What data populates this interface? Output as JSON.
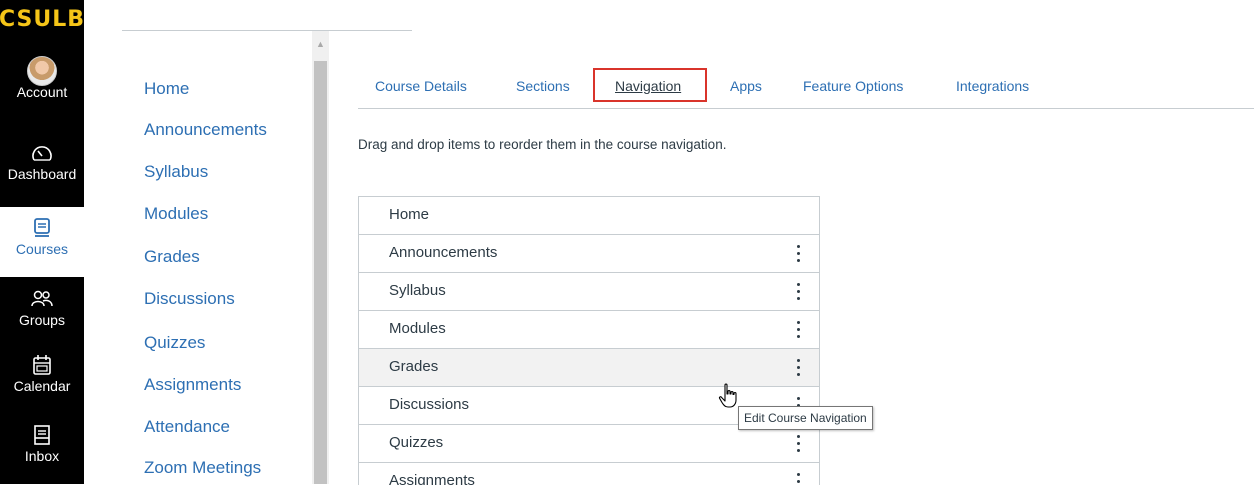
{
  "global_nav": {
    "logo": "CSULB",
    "items": [
      {
        "label": "Account",
        "icon": "avatar"
      },
      {
        "label": "Dashboard",
        "icon": "dashboard-icon"
      },
      {
        "label": "Courses",
        "icon": "courses-icon",
        "active": true
      },
      {
        "label": "Groups",
        "icon": "groups-icon"
      },
      {
        "label": "Calendar",
        "icon": "calendar-icon"
      },
      {
        "label": "Inbox",
        "icon": "inbox-icon"
      }
    ],
    "active_color": "#2d6fb3"
  },
  "course_nav": {
    "items": [
      "Home",
      "Announcements",
      "Syllabus",
      "Modules",
      "Grades",
      "Discussions",
      "Quizzes",
      "Assignments",
      "Attendance",
      "Zoom Meetings"
    ]
  },
  "tabs": [
    "Course Details",
    "Sections",
    "Navigation",
    "Apps",
    "Feature Options",
    "Integrations"
  ],
  "active_tab": "Navigation",
  "instruction": "Drag and drop items to reorder them in the course navigation.",
  "nav_list": [
    "Home",
    "Announcements",
    "Syllabus",
    "Modules",
    "Grades",
    "Discussions",
    "Quizzes",
    "Assignments"
  ],
  "tooltip": "Edit Course Navigation",
  "colors": {
    "link": "#2d6fb3",
    "highlight_box": "#d9342b",
    "logo": "#f5c518"
  }
}
